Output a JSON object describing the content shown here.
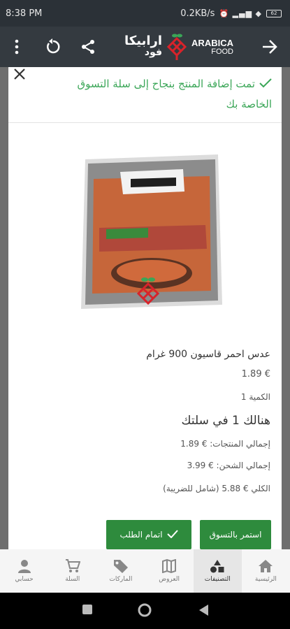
{
  "status_bar": {
    "time": "8:38 PM",
    "network": "0.2KB/s",
    "battery": "62"
  },
  "app": {
    "logo_ar_top": "ارابيكا",
    "logo_ar_bottom": "فود",
    "logo_en_top": "ARABICA",
    "logo_en_bottom": "FOOD"
  },
  "toast": {
    "message": "تمت إضافة المنتج بنجاح إلى سلة التسوق الخاصة بك"
  },
  "product": {
    "name": "عدس احمر قاسيون 900 غرام",
    "price": "€ 1.89",
    "quantity": "الكمية 1",
    "cart_count": "هنالك 1 في سلتك",
    "subtotal": "إجمالي المنتجات: € 1.89",
    "shipping": "إجمالي الشحن: € 3.99",
    "total": "الكلي € 5.88 (شامل للضريبة)"
  },
  "buttons": {
    "continue": "استمر بالتسوق",
    "checkout": "اتمام الطلب"
  },
  "nav": {
    "items": [
      {
        "label": "الرئيسية",
        "icon": "home-icon"
      },
      {
        "label": "التصنيفات",
        "icon": "categories-icon"
      },
      {
        "label": "العروض",
        "icon": "map-icon"
      },
      {
        "label": "الماركات",
        "icon": "tag-icon"
      },
      {
        "label": "السلة",
        "icon": "cart-icon"
      },
      {
        "label": "حسابي",
        "icon": "user-icon"
      }
    ]
  },
  "colors": {
    "accent": "#2e8b3d",
    "toast_text": "#3aa657",
    "app_bar": "#343a40"
  }
}
